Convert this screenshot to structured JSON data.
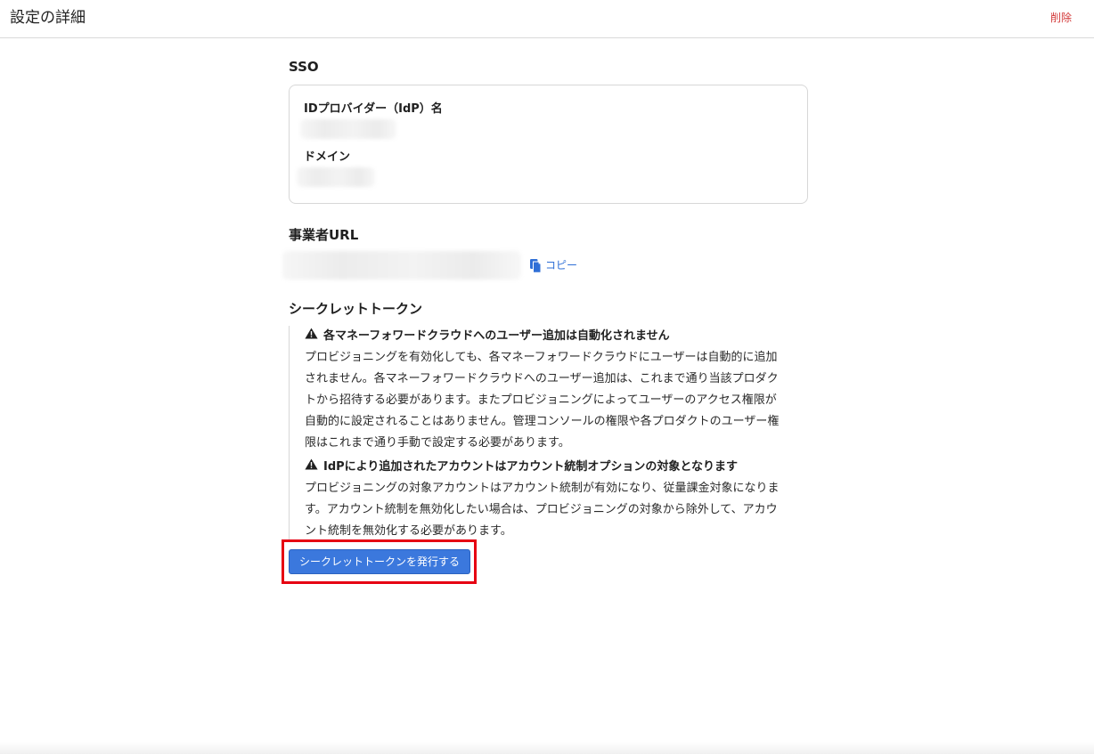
{
  "header": {
    "title": "設定の詳細",
    "delete_label": "削除"
  },
  "sso": {
    "section_title": "SSO",
    "idp_label": "IDプロバイダー（IdP）名",
    "domain_label": "ドメイン"
  },
  "business_url": {
    "section_title": "事業者URL",
    "copy_label": "コピー",
    "icon": "copy-icon"
  },
  "secret_token": {
    "section_title": "シークレットトークン",
    "notices": [
      {
        "icon": "warning-icon",
        "heading": "各マネーフォワードクラウドへのユーザー追加は自動化されません",
        "lines": [
          "プロビジョニングを有効化しても、各マネーフォワードクラウドにユーザーは自動的に追加",
          "されません。各マネーフォワードクラウドへのユーザー追加は、これまで通り当該プロダク",
          "トから招待する必要があります。またプロビジョニングによってユーザーのアクセス権限が",
          "自動的に設定されることはありません。管理コンソールの権限や各プロダクトのユーザー権",
          "限はこれまで通り手動で設定する必要があります。"
        ]
      },
      {
        "icon": "warning-icon",
        "heading": "IdPにより追加されたアカウントはアカウント統制オプションの対象となります",
        "lines": [
          "プロビジョニングの対象アカウントはアカウント統制が有効になり、従量課金対象になりま",
          "す。アカウント統制を無効化したい場合は、プロビジョニングの対象から除外して、アカウ",
          "ント統制を無効化する必要があります。"
        ]
      }
    ],
    "issue_button_label": "シークレットトークンを発行する"
  },
  "colors": {
    "danger": "#d33a3a",
    "link": "#2f6fd6",
    "primary_button": "#3b78dd",
    "highlight_border": "#e60012"
  }
}
